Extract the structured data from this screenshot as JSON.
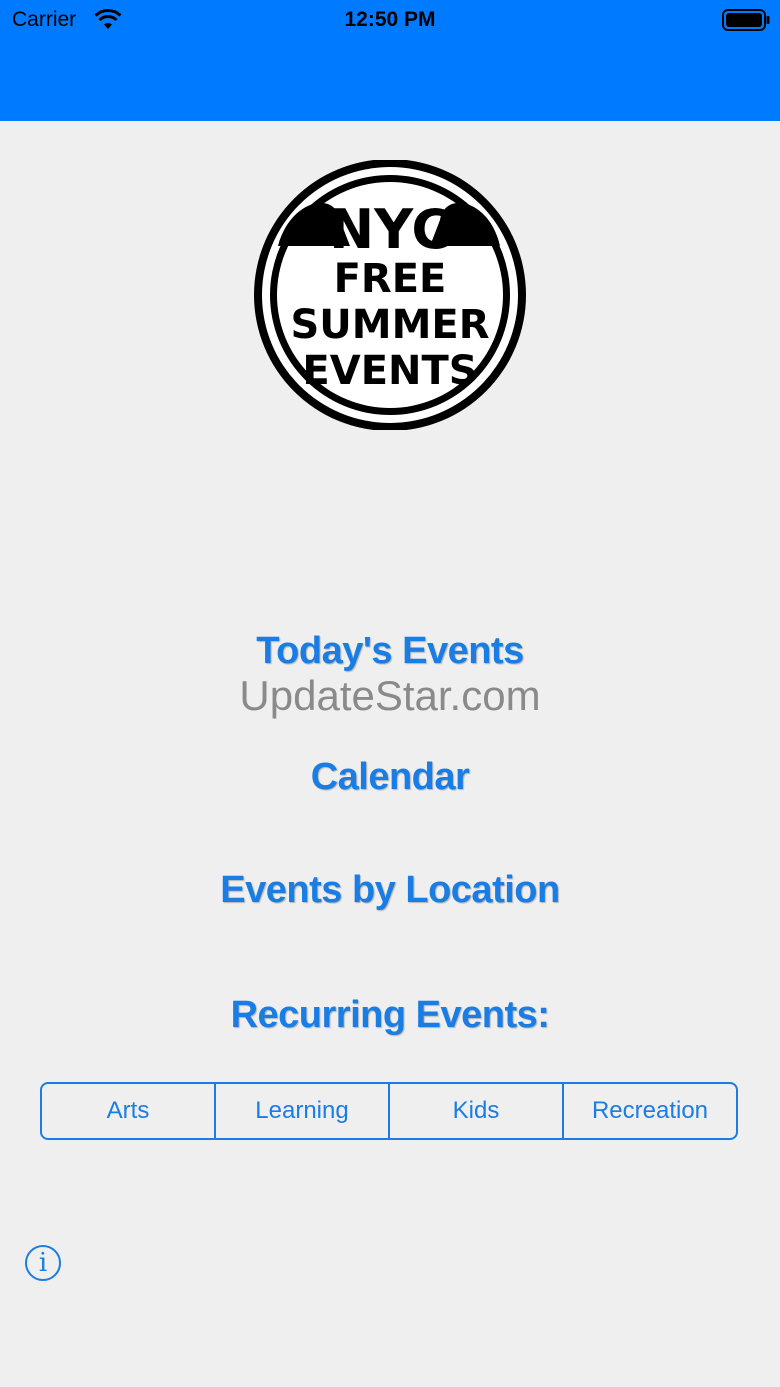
{
  "status_bar": {
    "carrier": "Carrier",
    "time": "12:50 PM",
    "wifi_icon": "wifi-icon",
    "battery_icon": "battery-icon"
  },
  "header": {
    "color": "#007aff"
  },
  "logo": {
    "line1": "NYC",
    "line2": "FREE",
    "line3": "SUMMER",
    "line4": "EVENTS"
  },
  "menu": {
    "todays_events": "Today's Events",
    "calendar": "Calendar",
    "events_by_location": "Events by Location",
    "recurring_events": "Recurring Events:"
  },
  "watermark": "UpdateStar.com",
  "recurring_segments": [
    {
      "label": "Arts"
    },
    {
      "label": "Learning"
    },
    {
      "label": "Kids"
    },
    {
      "label": "Recreation"
    }
  ],
  "info_button": {
    "icon": "info-icon",
    "glyph": "i"
  },
  "colors": {
    "accent": "#1a7de3",
    "background": "#efefef"
  }
}
